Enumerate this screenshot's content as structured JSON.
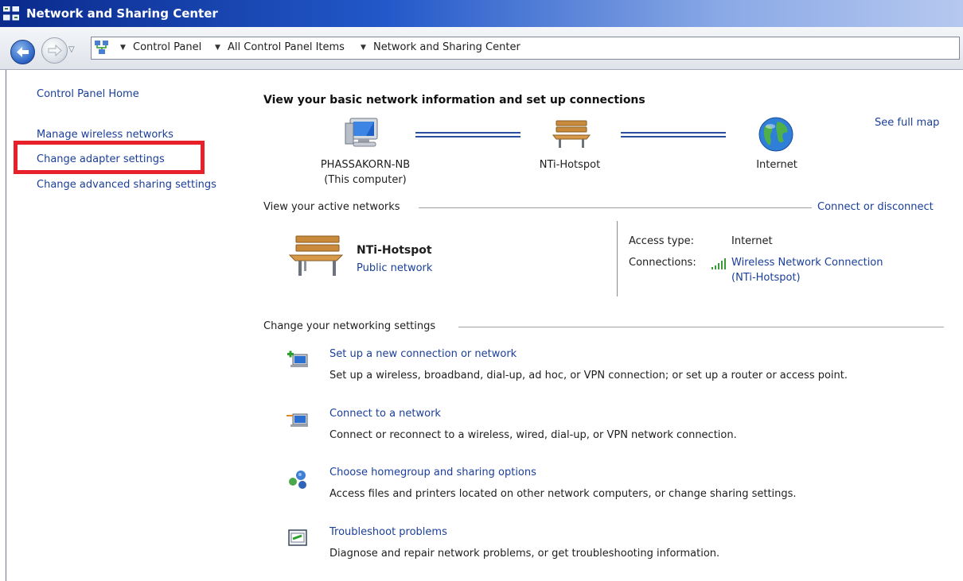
{
  "window": {
    "title": "Network and Sharing Center"
  },
  "address_bar": {
    "crumbs": [
      "Control Panel",
      "All Control Panel Items",
      "Network and Sharing Center"
    ]
  },
  "sidebar": {
    "home": "Control Panel Home",
    "items": [
      {
        "label": "Manage wireless networks"
      },
      {
        "label": "Change adapter settings"
      },
      {
        "label": "Change advanced sharing settings"
      }
    ]
  },
  "main": {
    "heading": "View your basic network information and set up connections",
    "see_full_map": "See full map",
    "map": {
      "computer_name": "PHASSAKORN-NB",
      "computer_sub": "(This computer)",
      "network_name": "NTi-Hotspot",
      "internet": "Internet"
    },
    "active_networks": {
      "label": "View your active networks",
      "connect_link": "Connect or disconnect",
      "network_name": "NTi-Hotspot",
      "network_type": "Public network",
      "access_type_label": "Access type:",
      "access_type_value": "Internet",
      "connections_label": "Connections:",
      "connection_name": "Wireless Network Connection",
      "connection_sub": "(NTi-Hotspot)"
    },
    "networking_settings": {
      "label": "Change your networking settings",
      "tasks": [
        {
          "title": "Set up a new connection or network",
          "desc": "Set up a wireless, broadband, dial-up, ad hoc, or VPN connection; or set up a router or access point."
        },
        {
          "title": "Connect to a network",
          "desc": "Connect or reconnect to a wireless, wired, dial-up, or VPN network connection."
        },
        {
          "title": "Choose homegroup and sharing options",
          "desc": "Access files and printers located on other network computers, or change sharing settings."
        },
        {
          "title": "Troubleshoot problems",
          "desc": "Diagnose and repair network problems, or get troubleshooting information."
        }
      ]
    }
  },
  "colors": {
    "link": "#1a3e9a",
    "highlight": "#e8202a",
    "title_bar": "#0a2a8c"
  }
}
